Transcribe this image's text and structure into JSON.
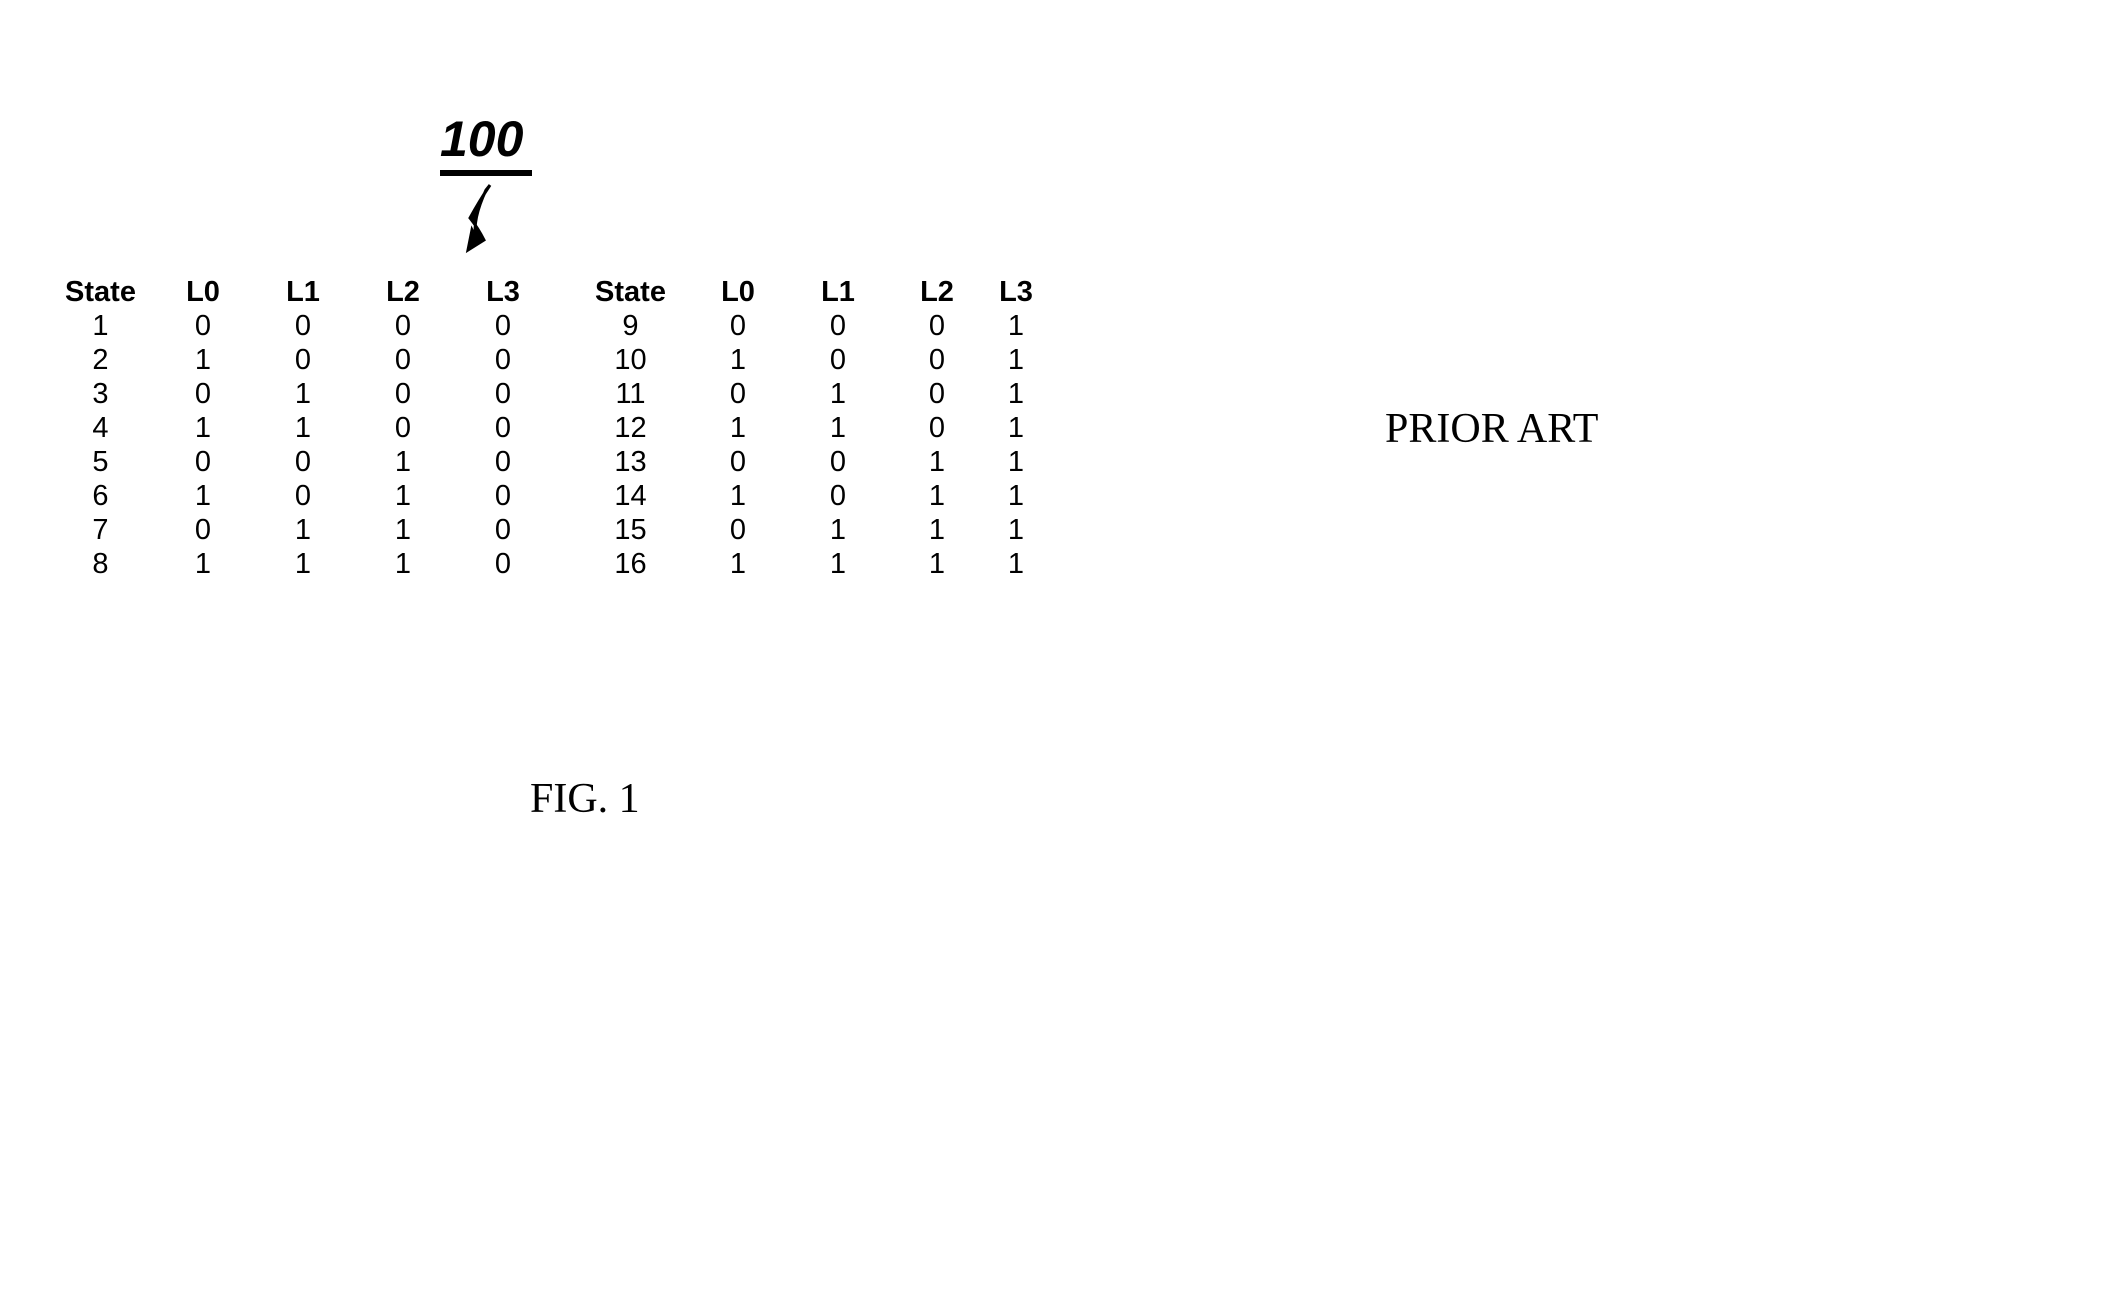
{
  "annotation_number": "100",
  "prior_art_label": "PRIOR ART",
  "figure_label": "FIG. 1",
  "table": {
    "headers_left": [
      "State",
      "L0",
      "L1",
      "L2",
      "L3"
    ],
    "headers_right": [
      "State",
      "L0",
      "L1",
      "L2",
      "L3"
    ],
    "rows_left": [
      [
        "1",
        "0",
        "0",
        "0",
        "0"
      ],
      [
        "2",
        "1",
        "0",
        "0",
        "0"
      ],
      [
        "3",
        "0",
        "1",
        "0",
        "0"
      ],
      [
        "4",
        "1",
        "1",
        "0",
        "0"
      ],
      [
        "5",
        "0",
        "0",
        "1",
        "0"
      ],
      [
        "6",
        "1",
        "0",
        "1",
        "0"
      ],
      [
        "7",
        "0",
        "1",
        "1",
        "0"
      ],
      [
        "8",
        "1",
        "1",
        "1",
        "0"
      ]
    ],
    "rows_right": [
      [
        "9",
        "0",
        "0",
        "0",
        "1"
      ],
      [
        "10",
        "1",
        "0",
        "0",
        "1"
      ],
      [
        "11",
        "0",
        "1",
        "0",
        "1"
      ],
      [
        "12",
        "1",
        "1",
        "0",
        "1"
      ],
      [
        "13",
        "0",
        "0",
        "1",
        "1"
      ],
      [
        "14",
        "1",
        "0",
        "1",
        "1"
      ],
      [
        "15",
        "0",
        "1",
        "1",
        "1"
      ],
      [
        "16",
        "1",
        "1",
        "1",
        "1"
      ]
    ]
  }
}
